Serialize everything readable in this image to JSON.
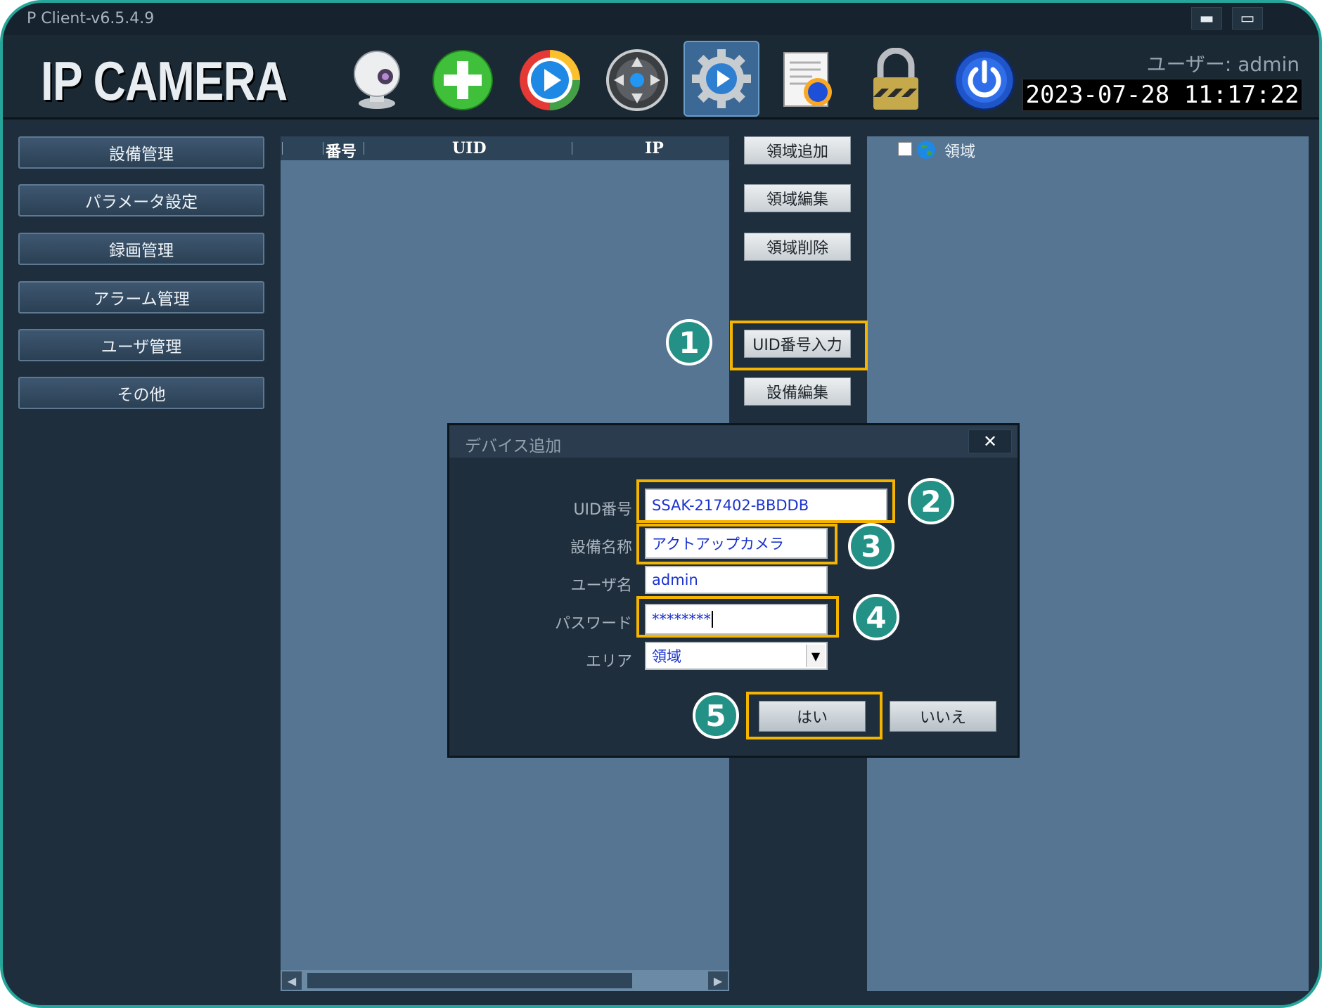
{
  "window": {
    "title": "P Client-v6.5.4.9",
    "minimize_glyph": "▬",
    "maximize_glyph": "▭"
  },
  "header": {
    "logo": "IP CAMERA",
    "user_label": "ユーザー: admin",
    "datetime": "2023-07-28  11:17:22",
    "toolbar_icons": [
      "webcam-icon",
      "add-icon",
      "play-icon",
      "ptz-control-icon",
      "settings-icon",
      "log-icon",
      "lock-icon",
      "power-icon"
    ]
  },
  "sidebar": {
    "items": [
      {
        "label": "設備管理"
      },
      {
        "label": "パラメータ設定"
      },
      {
        "label": "録画管理"
      },
      {
        "label": "アラーム管理"
      },
      {
        "label": "ユーザ管理"
      },
      {
        "label": "その他"
      }
    ]
  },
  "device_list": {
    "columns": [
      "番号",
      "UID",
      "IP"
    ],
    "scroll_left": "◀",
    "scroll_right": "▶"
  },
  "actions": {
    "add_area": "領域追加",
    "edit_area": "領域編集",
    "delete_area": "領域削除",
    "uid_input": "UID番号入力",
    "edit_device": "設備編集"
  },
  "area_tree": {
    "root_label": "領域"
  },
  "dialog": {
    "title": "デバイス追加",
    "close_glyph": "✕",
    "fields": {
      "uid_label": "UID番号",
      "uid_value": "SSAK-217402-BBDDB",
      "name_label": "設備名称",
      "name_value": "アクトアップカメラ",
      "user_label": "ユーザ名",
      "user_value": "admin",
      "password_label": "パスワード",
      "password_value": "********",
      "area_label": "エリア",
      "area_value": "領域",
      "area_arrow": "▼"
    },
    "yes_label": "はい",
    "no_label": "いいえ"
  },
  "annotations": {
    "step1": "1",
    "step2": "2",
    "step3": "3",
    "step4": "4",
    "step5": "5",
    "highlight_color": "#f5b400",
    "badge_color": "#239186"
  },
  "colors": {
    "app_bg": "#1f2e3d",
    "panel_bg": "#557592",
    "frame_border": "#26a69a"
  }
}
